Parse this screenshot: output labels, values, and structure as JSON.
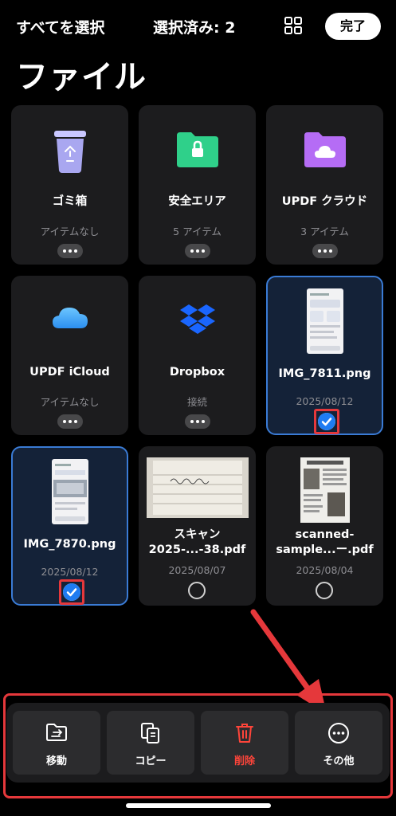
{
  "header": {
    "select_all": "すべてを選択",
    "selected_count": "選択済み: 2",
    "grid_icon": "grid-icon",
    "done": "完了"
  },
  "page_title": "ファイル",
  "items": [
    {
      "name": "ゴミ箱",
      "sub": "アイテムなし",
      "icon": "trash-icon",
      "accent": "#a9a7f0"
    },
    {
      "name": "安全エリア",
      "sub": "5 アイテム",
      "icon": "lock-folder-icon",
      "accent": "#2fd08a"
    },
    {
      "name": "UPDF クラウド",
      "sub": "3 アイテム",
      "icon": "cloud-folder-icon",
      "accent": "#b56cf5"
    },
    {
      "name": "UPDF iCloud",
      "sub": "アイテムなし",
      "icon": "icloud-icon",
      "accent": "#3fa9f5"
    },
    {
      "name": "Dropbox",
      "sub": "接続",
      "icon": "dropbox-icon",
      "accent": "#1a66ff"
    },
    {
      "name": "IMG_7811.png",
      "sub": "2025/08/12",
      "icon": "image-thumbnail",
      "selected": true
    },
    {
      "name": "IMG_7870.png",
      "sub": "2025/08/12",
      "icon": "image-thumbnail",
      "selected": true
    },
    {
      "name": "スキャン\n2025-...-38.pdf",
      "sub": "2025/08/07",
      "icon": "pdf-thumbnail",
      "selected": false
    },
    {
      "name": "scanned-\nsample...ー.pdf",
      "sub": "2025/08/04",
      "icon": "pdf-thumbnail",
      "selected": false
    }
  ],
  "toolbar": {
    "move": "移動",
    "copy": "コピー",
    "delete": "削除",
    "more": "その他"
  },
  "colors": {
    "background": "#000000",
    "card": "#1c1c1e",
    "selected_border": "#3a7bd5",
    "danger": "#ff453a",
    "annotation": "#e5383b"
  }
}
